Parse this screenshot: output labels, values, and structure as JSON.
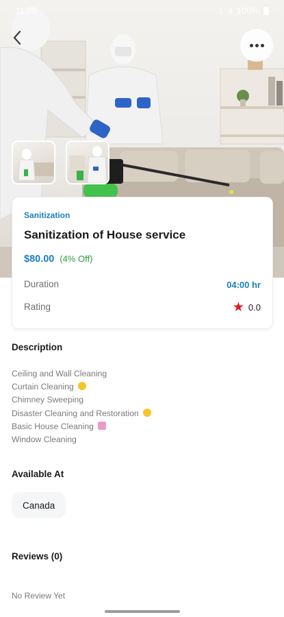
{
  "status_bar": {
    "time": "11:09",
    "signal_text": "‡ .ıl",
    "battery": "100%"
  },
  "hero": {
    "image": "workers in protective suits disinfecting a living room"
  },
  "service": {
    "category": "Sanitization",
    "title": "Sanitization of House service",
    "price": "$80.00",
    "discount": "(4% Off)",
    "duration_label": "Duration",
    "duration_value": "04:00 hr",
    "rating_label": "Rating",
    "rating_value": "0.0"
  },
  "description": {
    "title": "Description",
    "items": [
      "Ceiling and Wall Cleaning",
      "Curtain Cleaning",
      "Chimney Sweeping",
      "Disaster Cleaning and Restoration",
      "Basic House Cleaning",
      "Window Cleaning"
    ]
  },
  "available": {
    "title": "Available At",
    "location": "Canada"
  },
  "reviews": {
    "title": "Reviews (0)",
    "empty_text": "No Review Yet"
  },
  "colors": {
    "accent": "#1b7fbf",
    "discount": "#2e9c3f",
    "star": "#e01b24"
  },
  "icons": [
    "back-arrow-icon",
    "more-icon",
    "star-icon"
  ]
}
